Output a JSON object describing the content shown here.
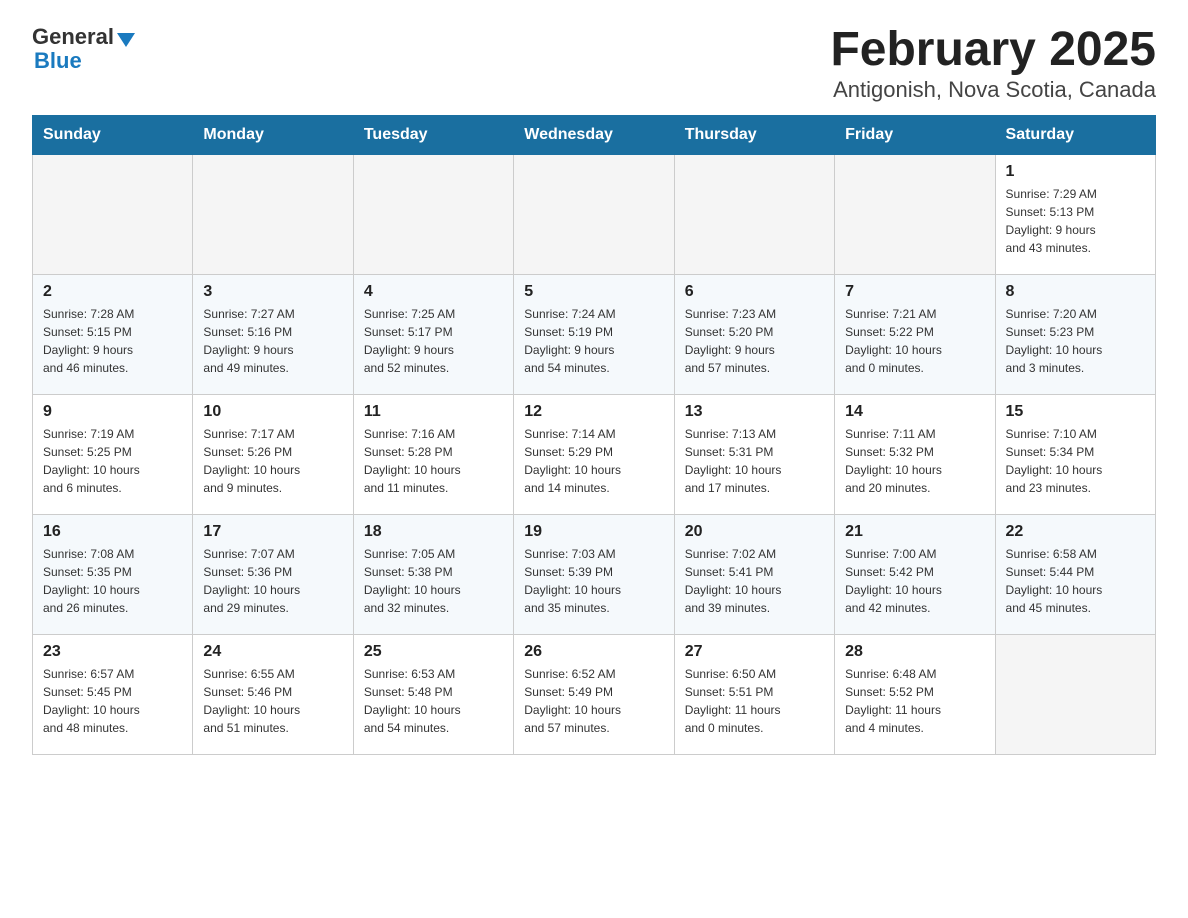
{
  "header": {
    "logo_general": "General",
    "logo_blue": "Blue",
    "title": "February 2025",
    "subtitle": "Antigonish, Nova Scotia, Canada"
  },
  "days_of_week": [
    "Sunday",
    "Monday",
    "Tuesday",
    "Wednesday",
    "Thursday",
    "Friday",
    "Saturday"
  ],
  "weeks": [
    {
      "days": [
        {
          "num": "",
          "info": ""
        },
        {
          "num": "",
          "info": ""
        },
        {
          "num": "",
          "info": ""
        },
        {
          "num": "",
          "info": ""
        },
        {
          "num": "",
          "info": ""
        },
        {
          "num": "",
          "info": ""
        },
        {
          "num": "1",
          "info": "Sunrise: 7:29 AM\nSunset: 5:13 PM\nDaylight: 9 hours\nand 43 minutes."
        }
      ]
    },
    {
      "days": [
        {
          "num": "2",
          "info": "Sunrise: 7:28 AM\nSunset: 5:15 PM\nDaylight: 9 hours\nand 46 minutes."
        },
        {
          "num": "3",
          "info": "Sunrise: 7:27 AM\nSunset: 5:16 PM\nDaylight: 9 hours\nand 49 minutes."
        },
        {
          "num": "4",
          "info": "Sunrise: 7:25 AM\nSunset: 5:17 PM\nDaylight: 9 hours\nand 52 minutes."
        },
        {
          "num": "5",
          "info": "Sunrise: 7:24 AM\nSunset: 5:19 PM\nDaylight: 9 hours\nand 54 minutes."
        },
        {
          "num": "6",
          "info": "Sunrise: 7:23 AM\nSunset: 5:20 PM\nDaylight: 9 hours\nand 57 minutes."
        },
        {
          "num": "7",
          "info": "Sunrise: 7:21 AM\nSunset: 5:22 PM\nDaylight: 10 hours\nand 0 minutes."
        },
        {
          "num": "8",
          "info": "Sunrise: 7:20 AM\nSunset: 5:23 PM\nDaylight: 10 hours\nand 3 minutes."
        }
      ]
    },
    {
      "days": [
        {
          "num": "9",
          "info": "Sunrise: 7:19 AM\nSunset: 5:25 PM\nDaylight: 10 hours\nand 6 minutes."
        },
        {
          "num": "10",
          "info": "Sunrise: 7:17 AM\nSunset: 5:26 PM\nDaylight: 10 hours\nand 9 minutes."
        },
        {
          "num": "11",
          "info": "Sunrise: 7:16 AM\nSunset: 5:28 PM\nDaylight: 10 hours\nand 11 minutes."
        },
        {
          "num": "12",
          "info": "Sunrise: 7:14 AM\nSunset: 5:29 PM\nDaylight: 10 hours\nand 14 minutes."
        },
        {
          "num": "13",
          "info": "Sunrise: 7:13 AM\nSunset: 5:31 PM\nDaylight: 10 hours\nand 17 minutes."
        },
        {
          "num": "14",
          "info": "Sunrise: 7:11 AM\nSunset: 5:32 PM\nDaylight: 10 hours\nand 20 minutes."
        },
        {
          "num": "15",
          "info": "Sunrise: 7:10 AM\nSunset: 5:34 PM\nDaylight: 10 hours\nand 23 minutes."
        }
      ]
    },
    {
      "days": [
        {
          "num": "16",
          "info": "Sunrise: 7:08 AM\nSunset: 5:35 PM\nDaylight: 10 hours\nand 26 minutes."
        },
        {
          "num": "17",
          "info": "Sunrise: 7:07 AM\nSunset: 5:36 PM\nDaylight: 10 hours\nand 29 minutes."
        },
        {
          "num": "18",
          "info": "Sunrise: 7:05 AM\nSunset: 5:38 PM\nDaylight: 10 hours\nand 32 minutes."
        },
        {
          "num": "19",
          "info": "Sunrise: 7:03 AM\nSunset: 5:39 PM\nDaylight: 10 hours\nand 35 minutes."
        },
        {
          "num": "20",
          "info": "Sunrise: 7:02 AM\nSunset: 5:41 PM\nDaylight: 10 hours\nand 39 minutes."
        },
        {
          "num": "21",
          "info": "Sunrise: 7:00 AM\nSunset: 5:42 PM\nDaylight: 10 hours\nand 42 minutes."
        },
        {
          "num": "22",
          "info": "Sunrise: 6:58 AM\nSunset: 5:44 PM\nDaylight: 10 hours\nand 45 minutes."
        }
      ]
    },
    {
      "days": [
        {
          "num": "23",
          "info": "Sunrise: 6:57 AM\nSunset: 5:45 PM\nDaylight: 10 hours\nand 48 minutes."
        },
        {
          "num": "24",
          "info": "Sunrise: 6:55 AM\nSunset: 5:46 PM\nDaylight: 10 hours\nand 51 minutes."
        },
        {
          "num": "25",
          "info": "Sunrise: 6:53 AM\nSunset: 5:48 PM\nDaylight: 10 hours\nand 54 minutes."
        },
        {
          "num": "26",
          "info": "Sunrise: 6:52 AM\nSunset: 5:49 PM\nDaylight: 10 hours\nand 57 minutes."
        },
        {
          "num": "27",
          "info": "Sunrise: 6:50 AM\nSunset: 5:51 PM\nDaylight: 11 hours\nand 0 minutes."
        },
        {
          "num": "28",
          "info": "Sunrise: 6:48 AM\nSunset: 5:52 PM\nDaylight: 11 hours\nand 4 minutes."
        },
        {
          "num": "",
          "info": ""
        }
      ]
    }
  ]
}
